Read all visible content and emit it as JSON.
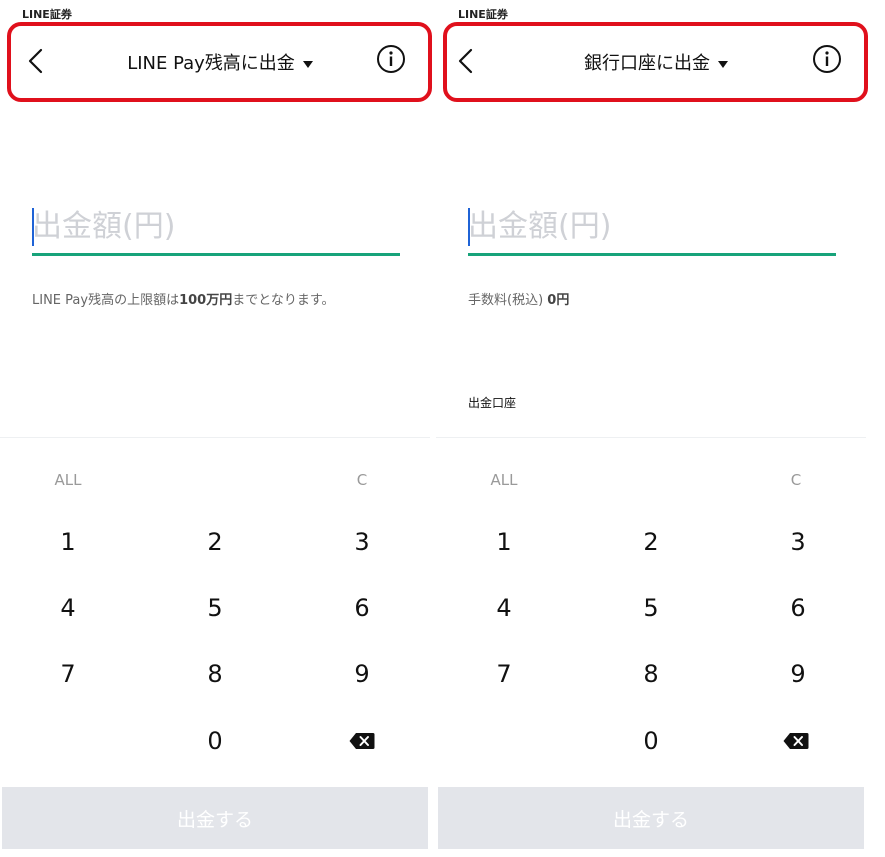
{
  "panels": [
    {
      "app_label": "LINE証券",
      "title": "LINE Pay残高に出金",
      "amount_placeholder": "出金額(円)",
      "note_prefix": "LINE Pay残高の上限額は",
      "note_bold": "100万円",
      "note_suffix": "までとなります。",
      "account_label": "",
      "keys": {
        "all": "ALL",
        "clear": "C",
        "k1": "1",
        "k2": "2",
        "k3": "3",
        "k4": "4",
        "k5": "5",
        "k6": "6",
        "k7": "7",
        "k8": "8",
        "k9": "9",
        "k0": "0"
      },
      "submit_label": "出金する"
    },
    {
      "app_label": "LINE証券",
      "title": "銀行口座に出金",
      "amount_placeholder": "出金額(円)",
      "note_prefix": "手数料(税込) ",
      "note_bold": "0円",
      "note_suffix": "",
      "account_label": "出金口座",
      "keys": {
        "all": "ALL",
        "clear": "C",
        "k1": "1",
        "k2": "2",
        "k3": "3",
        "k4": "4",
        "k5": "5",
        "k6": "6",
        "k7": "7",
        "k8": "8",
        "k9": "9",
        "k0": "0"
      },
      "submit_label": "出金する"
    }
  ],
  "colors": {
    "highlight": "#e0101c",
    "accent_underline": "#17a37a",
    "cursor": "#1f63d6",
    "placeholder": "#cfd1d6",
    "submit_disabled_bg": "#e3e5ea"
  },
  "icons": {
    "back": "chevron-left-icon",
    "info": "info-circle-icon",
    "dropdown": "caret-down-icon",
    "backspace": "backspace-icon"
  }
}
